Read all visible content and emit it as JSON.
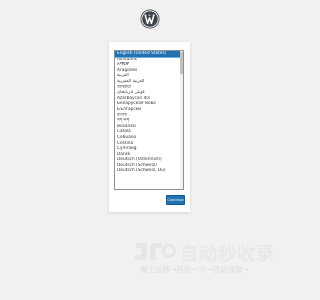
{
  "header": {
    "logo_icon": "wordpress-logo-icon"
  },
  "language_list": {
    "selected_index": 0,
    "items": [
      "English (United States)",
      "Afrikaans",
      "አማርኛ",
      "Aragonés",
      "العربية",
      "العربية المغربية",
      "অসমীয়া",
      "گؤنئی آذربایجان",
      "Azərbaycan dili",
      "Беларуская мова",
      "Български",
      "বাংলা",
      "བོད་ཡིག",
      "Bosanski",
      "Català",
      "Cebuano",
      "Čeština",
      "Cymraeg",
      "Dansk",
      "Deutsch (Österreich)",
      "Deutsch (Schweiz)",
      "Deutsch (Schweiz, Du)"
    ]
  },
  "actions": {
    "continue_label": "Continue"
  },
  "colors": {
    "background": "#f1f1f1",
    "accent": "#2271b1",
    "logo": "#3c434a"
  },
  "watermark": {
    "title": "自动秒收录",
    "subtitle": "做上品牌→首访一次→自动收录→"
  }
}
